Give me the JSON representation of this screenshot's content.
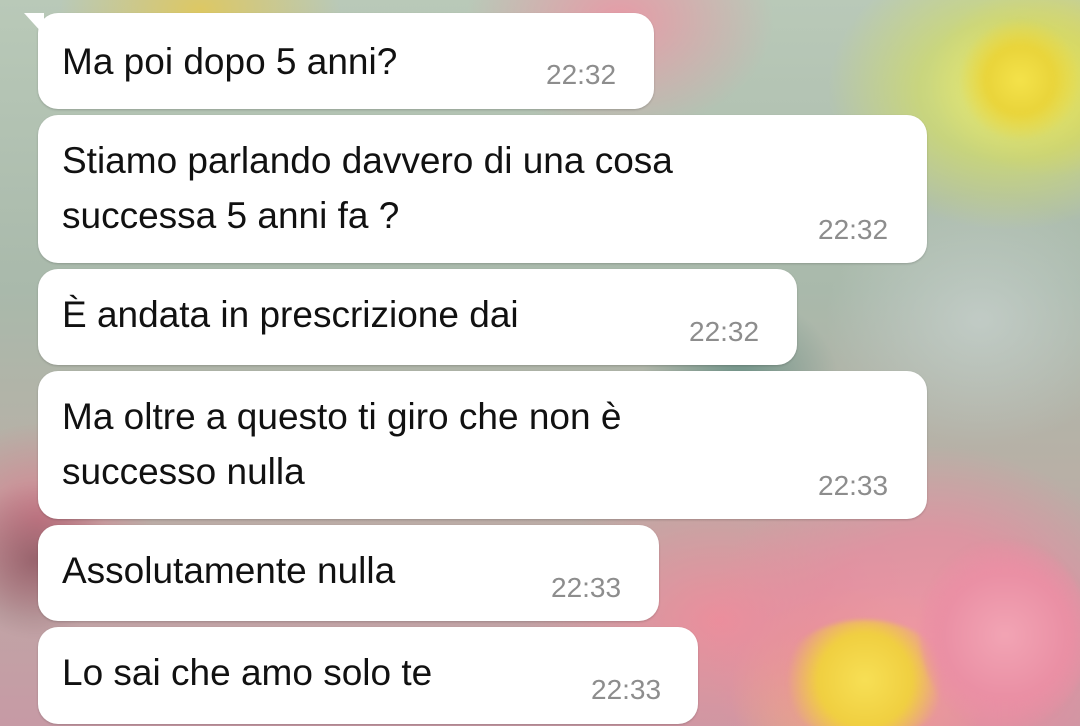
{
  "messages": [
    {
      "text": "Ma poi dopo 5 anni?",
      "time": "22:32"
    },
    {
      "text": "Stiamo parlando davvero di una cosa\nsuccessa 5 anni fa ?",
      "time": "22:32"
    },
    {
      "text": "È andata in prescrizione dai",
      "time": "22:32"
    },
    {
      "text": "Ma oltre a questo ti giro che non è\nsuccesso nulla",
      "time": "22:33"
    },
    {
      "text": "Assolutamente nulla",
      "time": "22:33"
    },
    {
      "text": "Lo sai che amo solo te",
      "time": "22:33"
    }
  ],
  "colors": {
    "bubble": "#ffffff",
    "text": "#111111",
    "timestamp": "#8d8d8d"
  }
}
